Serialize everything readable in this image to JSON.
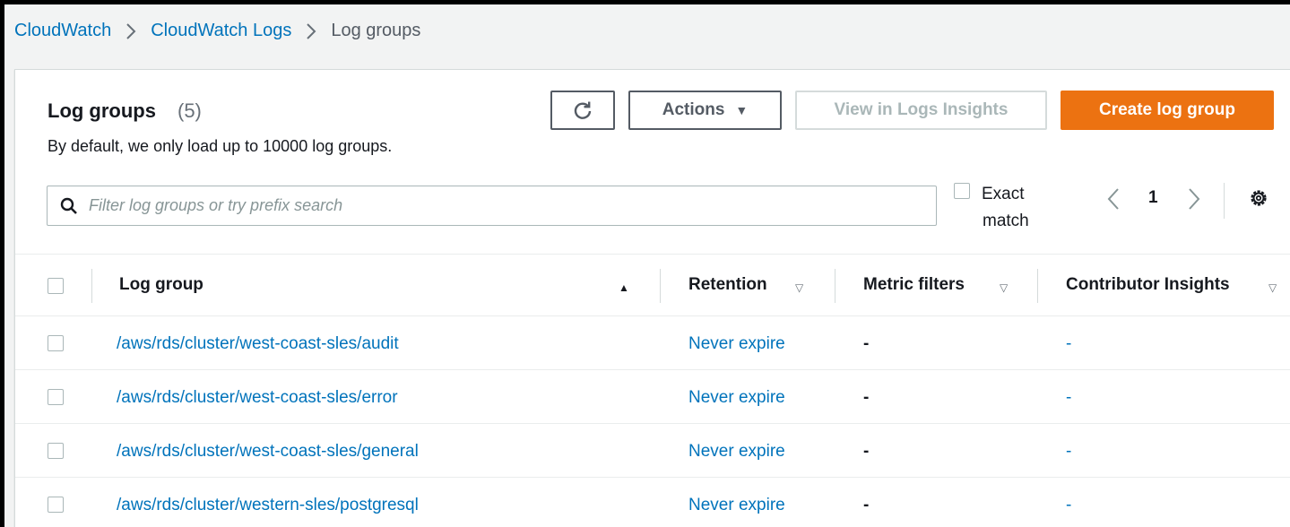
{
  "breadcrumb": {
    "items": [
      "CloudWatch",
      "CloudWatch Logs"
    ],
    "current": "Log groups"
  },
  "header": {
    "title": "Log groups",
    "count": "(5)",
    "subtitle": "By default, we only load up to 10000 log groups."
  },
  "toolbar": {
    "refresh_icon": "refresh-icon",
    "actions_label": "Actions",
    "view_insights_label": "View in Logs Insights",
    "create_label": "Create log group"
  },
  "search": {
    "placeholder": "Filter log groups or try prefix search",
    "value": ""
  },
  "exact_match": {
    "line1": "Exact",
    "line2": "match",
    "checked": false
  },
  "pagination": {
    "page": "1"
  },
  "table": {
    "columns": {
      "log_group": "Log group",
      "retention": "Retention",
      "metric_filters": "Metric filters",
      "contributor_insights": "Contributor Insights"
    },
    "rows": [
      {
        "log_group": "/aws/rds/cluster/west-coast-sles/audit",
        "retention": "Never expire",
        "metric_filters": "-",
        "contributor_insights": "-"
      },
      {
        "log_group": "/aws/rds/cluster/west-coast-sles/error",
        "retention": "Never expire",
        "metric_filters": "-",
        "contributor_insights": "-"
      },
      {
        "log_group": "/aws/rds/cluster/west-coast-sles/general",
        "retention": "Never expire",
        "metric_filters": "-",
        "contributor_insights": "-"
      },
      {
        "log_group": "/aws/rds/cluster/western-sles/postgresql",
        "retention": "Never expire",
        "metric_filters": "-",
        "contributor_insights": "-"
      }
    ]
  },
  "colors": {
    "link": "#0073bb",
    "primary": "#ec7211",
    "background": "#f2f3f3"
  }
}
